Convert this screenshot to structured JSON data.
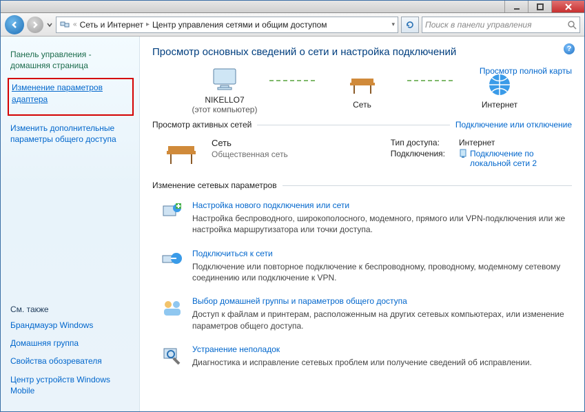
{
  "titlebar": {},
  "nav": {
    "crumb1": "Сеть и Интернет",
    "crumb2": "Центр управления сетями и общим доступом",
    "search_placeholder": "Поиск в панели управления"
  },
  "sidebar": {
    "home": "Панель управления - домашняя страница",
    "link_adapter": "Изменение параметров адаптера",
    "link_sharing": "Изменить дополнительные параметры общего доступа",
    "see_also": "См. также",
    "also": {
      "firewall": "Брандмауэр Windows",
      "homegroup": "Домашняя группа",
      "ie": "Свойства обозревателя",
      "wmc": "Центр устройств Windows Mobile"
    }
  },
  "main": {
    "heading": "Просмотр основных сведений о сети и настройка подключений",
    "full_map": "Просмотр полной карты",
    "node_pc": "NIKELLO7",
    "node_pc_sub": "(этот компьютер)",
    "node_net": "Сеть",
    "node_inet": "Интернет",
    "active_head": "Просмотр активных сетей",
    "active_link": "Подключение или отключение",
    "net_name": "Сеть",
    "net_type": "Общественная сеть",
    "access_lbl": "Тип доступа:",
    "access_val": "Интернет",
    "conn_lbl": "Подключения:",
    "conn_val": "Подключение по локальной сети 2",
    "change_head": "Изменение сетевых параметров",
    "tasks": {
      "t1_title": "Настройка нового подключения или сети",
      "t1_desc": "Настройка беспроводного, широкополосного, модемного, прямого или VPN-подключения или же настройка маршрутизатора или точки доступа.",
      "t2_title": "Подключиться к сети",
      "t2_desc": "Подключение или повторное подключение к беспроводному, проводному, модемному сетевому соединению или подключение к VPN.",
      "t3_title": "Выбор домашней группы и параметров общего доступа",
      "t3_desc": "Доступ к файлам и принтерам, расположенным на других сетевых компьютерах, или изменение параметров общего доступа.",
      "t4_title": "Устранение неполадок",
      "t4_desc": "Диагностика и исправление сетевых проблем или получение сведений об исправлении."
    }
  }
}
